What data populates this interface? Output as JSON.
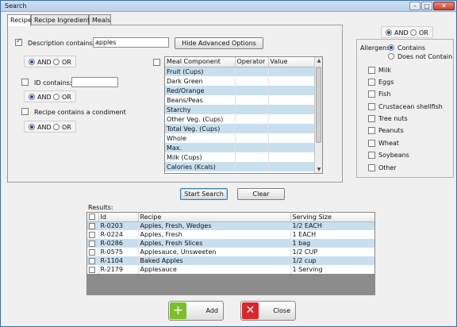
{
  "window": {
    "title": "Search",
    "controls": {
      "minimize": "–",
      "maximize": "□",
      "close": "✕"
    }
  },
  "tabs": [
    {
      "label": "Recipe"
    },
    {
      "label": "Recipe Ingredient"
    },
    {
      "label": "Meals"
    }
  ],
  "recipe_tab": {
    "description_label": "Description contains:",
    "description_value": "apples",
    "hide_advanced_label": "Hide Advanced Options",
    "and_label": "AND",
    "or_label": "OR",
    "id_label": "ID contains:",
    "id_value": "",
    "condiment_label": "Recipe contains a condiment"
  },
  "meal_component_grid": {
    "headers": [
      "Meal Component",
      "Operator",
      "Value"
    ],
    "rows": [
      "Fruit (Cups)",
      "Dark Green",
      "Red/Orange",
      "Beans/Peas",
      "Starchy",
      "Other Veg. (Cups)",
      "Total Veg. (Cups)",
      "Whole",
      "Max.",
      "Milk (Cups)",
      "Calories (Kcals)"
    ],
    "scroll_up": "▲",
    "scroll_down": "▼"
  },
  "allergens": {
    "top_and": "AND",
    "top_or": "OR",
    "title": "Allergens",
    "contains_label": "Contains",
    "not_contain_label": "Does not Contain",
    "items": [
      "Milk",
      "Eggs",
      "Fish",
      "Crustacean shellfish",
      "Tree nuts",
      "Peanuts",
      "Wheat",
      "Soybeans",
      "Other"
    ]
  },
  "actions": {
    "start_search": "Start Search",
    "clear": "Clear"
  },
  "results": {
    "label": "Results:",
    "headers": [
      "Id",
      "Recipe",
      "Serving Size"
    ],
    "rows": [
      {
        "id": "R-0203",
        "recipe": "Apples, Fresh, Wedges",
        "size": "1/2 EACH"
      },
      {
        "id": "R-0224",
        "recipe": "Apples, Fresh",
        "size": "1 EACH"
      },
      {
        "id": "R-0286",
        "recipe": "Apples, Fresh Slices",
        "size": "1 bag"
      },
      {
        "id": "R-0575",
        "recipe": "Applesauce, Unsweeten",
        "size": "1/2 CUP"
      },
      {
        "id": "R-1104",
        "recipe": "Baked Apples",
        "size": "1/2 cup"
      },
      {
        "id": "R-2179",
        "recipe": "Applesauce",
        "size": "1 Serving"
      }
    ]
  },
  "footer": {
    "add_label": "Add",
    "close_label": "Close",
    "add_icon": "+",
    "close_icon": "✕"
  },
  "colors": {
    "row_highlight": "#c8dff0",
    "add_green": "#7bbf2a",
    "close_red": "#d8282a"
  }
}
